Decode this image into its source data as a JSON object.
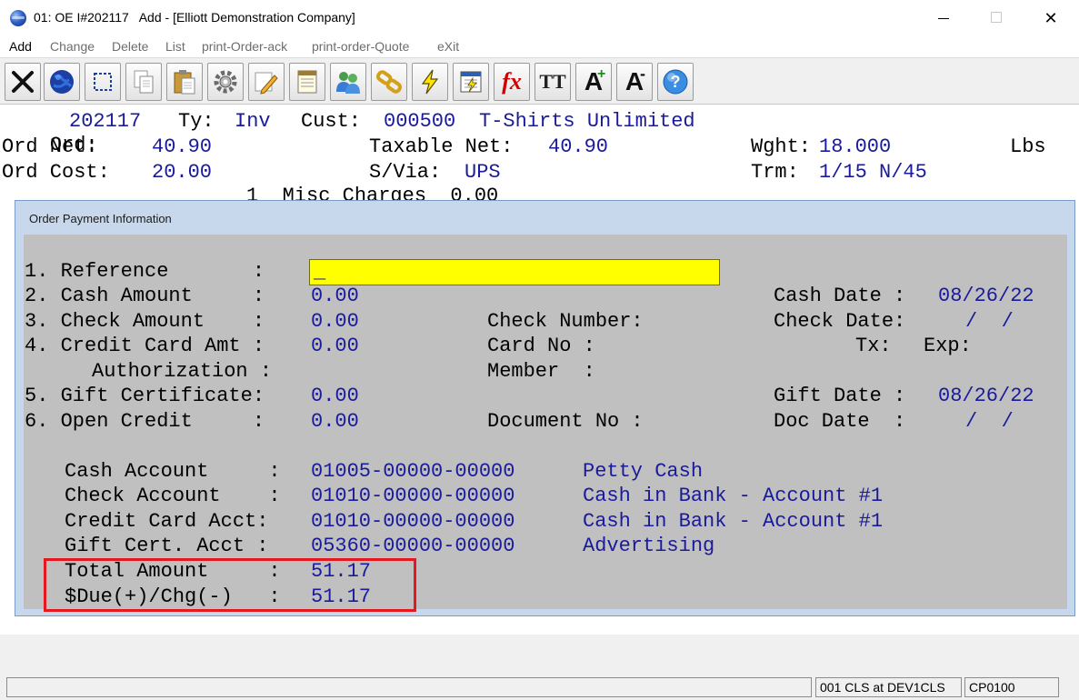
{
  "window": {
    "title": "01: OE I#202117   Add - [Elliott Demonstration Company]",
    "minimize": "—",
    "maximize": "☐",
    "close": "✕"
  },
  "menu": {
    "items": [
      "Add",
      "Change",
      "Delete",
      "List",
      "print-Order-ack",
      "print-order-Quote",
      "eXit"
    ]
  },
  "toolbar": {
    "buttons": [
      "exit-icon",
      "globe-icon",
      "select-icon",
      "copy-icon",
      "paste-icon",
      "settings-icon",
      "edit-icon",
      "notepad-icon",
      "users-icon",
      "link-icon",
      "lightning-icon",
      "calendar-icon",
      "function-icon",
      "font-icon",
      "increase-font-icon",
      "decrease-font-icon",
      "help-icon"
    ],
    "fx_label": "fx",
    "font_label": "TT",
    "inc_label": "A",
    "dec_label": "A",
    "help_label": "?"
  },
  "order": {
    "ord_label": "Ord:",
    "ord_no": "202117",
    "ty_label": "Ty:",
    "ty_value": "Inv",
    "cust_label": "Cust:",
    "cust_no": "000500",
    "cust_name": "T-Shirts Unlimited",
    "net_label": "Ord Net:",
    "net_value": "40.90",
    "taxable_label": "Taxable Net:",
    "taxable_value": "40.90",
    "weight_label": "Wght:",
    "weight_value": "18.000",
    "weight_unit": "Lbs",
    "cost_label": "Ord Cost:",
    "cost_value": "20.00",
    "ship_label": "S/Via:",
    "ship_value": "UPS",
    "terms_label": "Trm:",
    "terms_value": "1/15 N/45",
    "misc_line": "1  Misc Charges  0.00"
  },
  "dialog": {
    "title": "Order Payment Information",
    "reference_label": "1. Reference       :",
    "reference_value": "_",
    "cash_label": "2. Cash Amount     :",
    "cash_value": "0.00",
    "cash_date_label": "Cash Date :",
    "cash_date_value": "08/26/22",
    "check_label": "3. Check Amount    :",
    "check_value": "0.00",
    "check_number_label": "Check Number:",
    "check_date_label": "Check Date:",
    "check_date_value": "/  /",
    "cc_label": "4. Credit Card Amt :",
    "cc_value": "0.00",
    "card_no_label": "Card No :",
    "tx_label": "Tx:",
    "exp_label": "Exp:",
    "auth_label": "Authorization :",
    "member_label": "Member  :",
    "gift_label": "5. Gift Certificate:",
    "gift_value": "0.00",
    "gift_date_label": "Gift Date :",
    "gift_date_value": "08/26/22",
    "open_label": "6. Open Credit     :",
    "open_value": "0.00",
    "doc_no_label": "Document No :",
    "doc_date_label": "Doc Date  :",
    "doc_date_value": "/  /",
    "cash_acct_label": "Cash Account     :",
    "cash_acct_value": "01005-00000-00000",
    "cash_acct_desc": "Petty Cash",
    "check_acct_label": "Check Account    :",
    "check_acct_value": "01010-00000-00000",
    "check_acct_desc": "Cash in Bank - Account #1",
    "cc_acct_label": "Credit Card Acct:",
    "cc_acct_value": "01010-00000-00000",
    "cc_acct_desc": "Cash in Bank - Account #1",
    "gift_acct_label": "Gift Cert. Acct :",
    "gift_acct_value": "05360-00000-00000",
    "gift_acct_desc": "Advertising",
    "total_label": "Total Amount     :",
    "total_value": "51.17",
    "due_label": "$Due(+)/Chg(-)   :",
    "due_value": "51.17",
    "highlight_color": "#e5181f"
  },
  "status": {
    "pane1": "",
    "pane2": "001 CLS at DEV1CLS",
    "pane3": "CP0100"
  }
}
